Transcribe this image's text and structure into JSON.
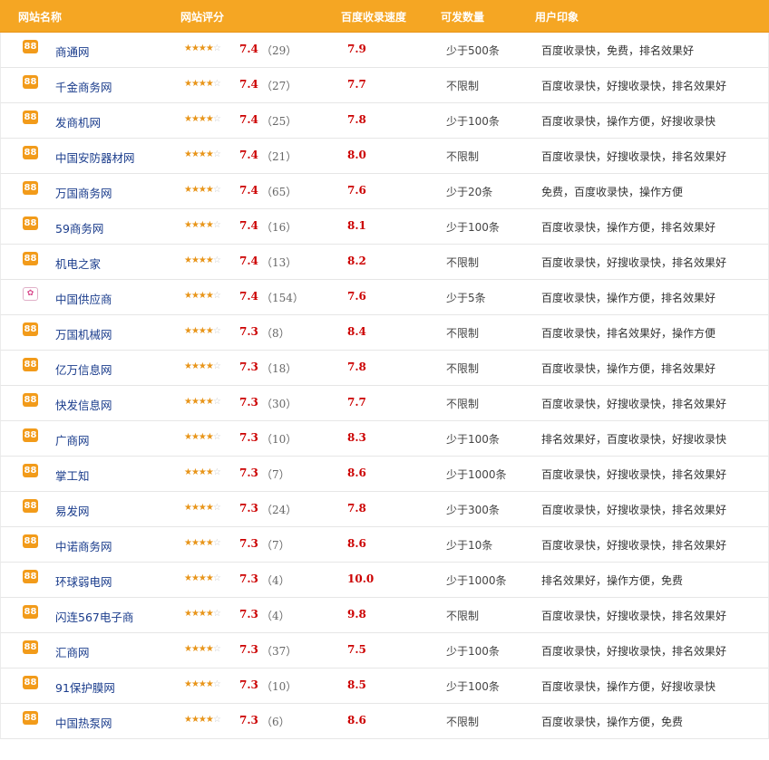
{
  "header": {
    "name": "网站名称",
    "rating": "网站评分",
    "speed": "百度收录速度",
    "quantity": "可发数量",
    "impression": "用户印象"
  },
  "colors": {
    "header_bg": "#f5a623",
    "score_red": "#cc0000",
    "link_blue": "#1a3c8c",
    "star_orange": "#e8951a"
  },
  "rows": [
    {
      "logo": "88",
      "name": "商通网",
      "stars": "★★★★☆",
      "score": "7.4",
      "count": "（29）",
      "speed": "7.9",
      "quantity": "少于500条",
      "impression": "百度收录快，免费，排名效果好"
    },
    {
      "logo": "88",
      "name": "千金商务网",
      "stars": "★★★★☆",
      "score": "7.4",
      "count": "（27）",
      "speed": "7.7",
      "quantity": "不限制",
      "impression": "百度收录快，好搜收录快，排名效果好"
    },
    {
      "logo": "88",
      "name": "发商机网",
      "stars": "★★★★☆",
      "score": "7.4",
      "count": "（25）",
      "speed": "7.8",
      "quantity": "少于100条",
      "impression": "百度收录快，操作方便，好搜收录快"
    },
    {
      "logo": "88",
      "name": "中国安防器材网",
      "stars": "★★★★☆",
      "score": "7.4",
      "count": "（21）",
      "speed": "8.0",
      "quantity": "不限制",
      "impression": "百度收录快，好搜收录快，排名效果好"
    },
    {
      "logo": "88",
      "name": "万国商务网",
      "stars": "★★★★☆",
      "score": "7.4",
      "count": "（65）",
      "speed": "7.6",
      "quantity": "少于20条",
      "impression": "免费，百度收录快，操作方便"
    },
    {
      "logo": "88",
      "name": "59商务网",
      "stars": "★★★★☆",
      "score": "7.4",
      "count": "（16）",
      "speed": "8.1",
      "quantity": "少于100条",
      "impression": "百度收录快，操作方便，排名效果好"
    },
    {
      "logo": "88",
      "name": "机电之家",
      "stars": "★★★★☆",
      "score": "7.4",
      "count": "（13）",
      "speed": "8.2",
      "quantity": "不限制",
      "impression": "百度收录快，好搜收录快，排名效果好"
    },
    {
      "logo": "✿",
      "name": "中国供应商",
      "stars": "★★★★☆",
      "score": "7.4",
      "count": "（154）",
      "speed": "7.6",
      "quantity": "少于5条",
      "impression": "百度收录快，操作方便，排名效果好",
      "alt_logo": true
    },
    {
      "logo": "88",
      "name": "万国机械网",
      "stars": "★★★★☆",
      "score": "7.3",
      "count": "（8）",
      "speed": "8.4",
      "quantity": "不限制",
      "impression": "百度收录快，排名效果好，操作方便"
    },
    {
      "logo": "88",
      "name": "亿万信息网",
      "stars": "★★★★☆",
      "score": "7.3",
      "count": "（18）",
      "speed": "7.8",
      "quantity": "不限制",
      "impression": "百度收录快，操作方便，排名效果好"
    },
    {
      "logo": "88",
      "name": "快发信息网",
      "stars": "★★★★☆",
      "score": "7.3",
      "count": "（30）",
      "speed": "7.7",
      "quantity": "不限制",
      "impression": "百度收录快，好搜收录快，排名效果好"
    },
    {
      "logo": "88",
      "name": "广商网",
      "stars": "★★★★☆",
      "score": "7.3",
      "count": "（10）",
      "speed": "8.3",
      "quantity": "少于100条",
      "impression": "排名效果好，百度收录快，好搜收录快"
    },
    {
      "logo": "88",
      "name": "掌工知",
      "stars": "★★★★☆",
      "score": "7.3",
      "count": "（7）",
      "speed": "8.6",
      "quantity": "少于1000条",
      "impression": "百度收录快，好搜收录快，排名效果好"
    },
    {
      "logo": "88",
      "name": "易发网",
      "stars": "★★★★☆",
      "score": "7.3",
      "count": "（24）",
      "speed": "7.8",
      "quantity": "少于300条",
      "impression": "百度收录快，好搜收录快，排名效果好"
    },
    {
      "logo": "88",
      "name": "中诺商务网",
      "stars": "★★★★☆",
      "score": "7.3",
      "count": "（7）",
      "speed": "8.6",
      "quantity": "少于10条",
      "impression": "百度收录快，好搜收录快，排名效果好"
    },
    {
      "logo": "88",
      "name": "环球弱电网",
      "stars": "★★★★☆",
      "score": "7.3",
      "count": "（4）",
      "speed": "10.0",
      "quantity": "少于1000条",
      "impression": "排名效果好，操作方便，免费"
    },
    {
      "logo": "88",
      "name": "闪连567电子商",
      "stars": "★★★★☆",
      "score": "7.3",
      "count": "（4）",
      "speed": "9.8",
      "quantity": "不限制",
      "impression": "百度收录快，好搜收录快，排名效果好"
    },
    {
      "logo": "88",
      "name": "汇商网",
      "stars": "★★★★☆",
      "score": "7.3",
      "count": "（37）",
      "speed": "7.5",
      "quantity": "少于100条",
      "impression": "百度收录快，好搜收录快，排名效果好"
    },
    {
      "logo": "88",
      "name": "91保护膜网",
      "stars": "★★★★☆",
      "score": "7.3",
      "count": "（10）",
      "speed": "8.5",
      "quantity": "少于100条",
      "impression": "百度收录快，操作方便，好搜收录快"
    },
    {
      "logo": "88",
      "name": "中国热泵网",
      "stars": "★★★★☆",
      "score": "7.3",
      "count": "（6）",
      "speed": "8.6",
      "quantity": "不限制",
      "impression": "百度收录快，操作方便，免费"
    }
  ]
}
